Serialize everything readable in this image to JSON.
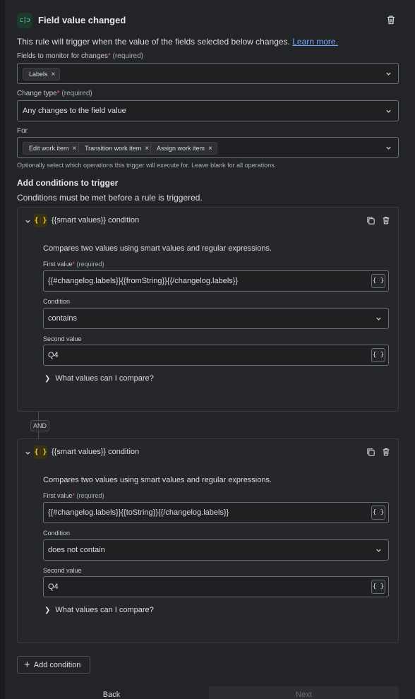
{
  "header": {
    "icon_glyph": "c|ɔ",
    "title": "Field value changed",
    "icons": {
      "trigger": "code-bracket-icon",
      "delete": "trash-icon"
    }
  },
  "intro": {
    "text": "This rule will trigger when the value of the fields selected below changes.",
    "link": "Learn more."
  },
  "fields_monitor": {
    "label": "Fields to monitor for changes",
    "required_note": "(required)",
    "tags": [
      "Labels"
    ]
  },
  "change_type": {
    "label": "Change type",
    "required_note": "(required)",
    "value": "Any changes to the field value"
  },
  "for_field": {
    "label": "For",
    "tags": [
      "Edit work item",
      "Transition work item",
      "Assign work item"
    ],
    "helper": "Optionally select which operations this trigger will execute for. Leave blank for all operations."
  },
  "conditions_section": {
    "title": "Add conditions to trigger",
    "subtitle": "Conditions must be met before a rule is triggered."
  },
  "conditions": [
    {
      "icon_glyph": "{ }",
      "title": "{{smart values}} condition",
      "description": "Compares two values using smart values and regular expressions.",
      "first_label": "First value",
      "first_required": "(required)",
      "first_value": "{{#changelog.labels}}{{fromString}}{{/changelog.labels}}",
      "condition_label": "Condition",
      "condition_value": "contains",
      "second_label": "Second value",
      "second_value": "Q4",
      "smart_button": "{ }",
      "what_values": "What values can I compare?"
    },
    {
      "icon_glyph": "{ }",
      "title": "{{smart values}} condition",
      "description": "Compares two values using smart values and regular expressions.",
      "first_label": "First value",
      "first_required": "(required)",
      "first_value": "{{#changelog.labels}}{{toString}}{{/changelog.labels}}",
      "condition_label": "Condition",
      "condition_value": "does not contain",
      "second_label": "Second value",
      "second_value": "Q4",
      "smart_button": "{ }",
      "what_values": "What values can I compare?"
    }
  ],
  "and_label": "AND",
  "add_condition": "Add condition",
  "footer": {
    "back": "Back",
    "next": "Next"
  },
  "colors": {
    "background": "#232427",
    "field_border": "#6b6e76",
    "link": "#6ea8ff",
    "required": "#f15b50",
    "smart_icon": "#f3c630",
    "trigger_icon": "#6fd0a0"
  }
}
